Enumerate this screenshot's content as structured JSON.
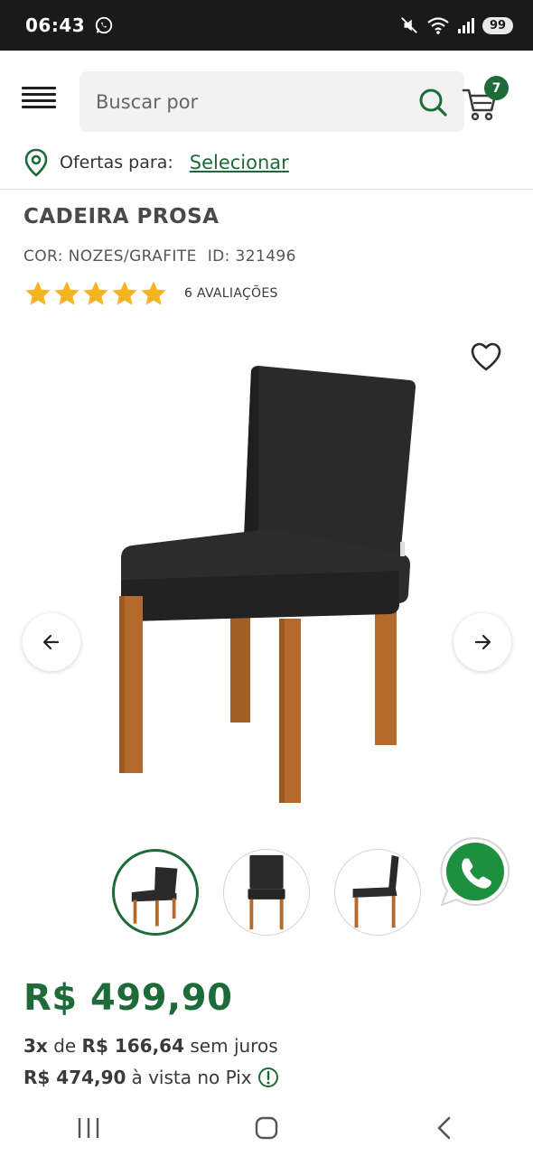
{
  "status_bar": {
    "time": "06:43",
    "battery": "99"
  },
  "header": {
    "search_placeholder": "Buscar por",
    "cart_count": "7"
  },
  "location": {
    "label": "Ofertas para:",
    "link": "Selecionar"
  },
  "product": {
    "title": "CADEIRA PROSA",
    "color": "COR: NOZES/GRAFITE",
    "id": "ID: 321496",
    "rating_stars": 5,
    "rating_count": "6 AVALIAÇÕES"
  },
  "pricing": {
    "price": "R$ 499,90",
    "installment_count": "3x",
    "installment_de": "de",
    "installment_value": "R$ 166,64",
    "installment_suffix": "sem juros",
    "pix_price": "R$ 474,90",
    "pix_suffix": "à vista no Pix"
  },
  "colors": {
    "brand_green": "#1e6b3a",
    "star": "#f5b320",
    "chair_fabric": "#2a2a2a",
    "chair_wood": "#b36a2c"
  },
  "icons": {
    "menu": "hamburger-icon",
    "search": "search-icon",
    "cart": "cart-icon",
    "location": "location-pin-icon",
    "favorite": "heart-icon",
    "prev": "arrow-left-icon",
    "next": "arrow-right-icon",
    "whatsapp": "whatsapp-icon",
    "info": "info-icon"
  }
}
